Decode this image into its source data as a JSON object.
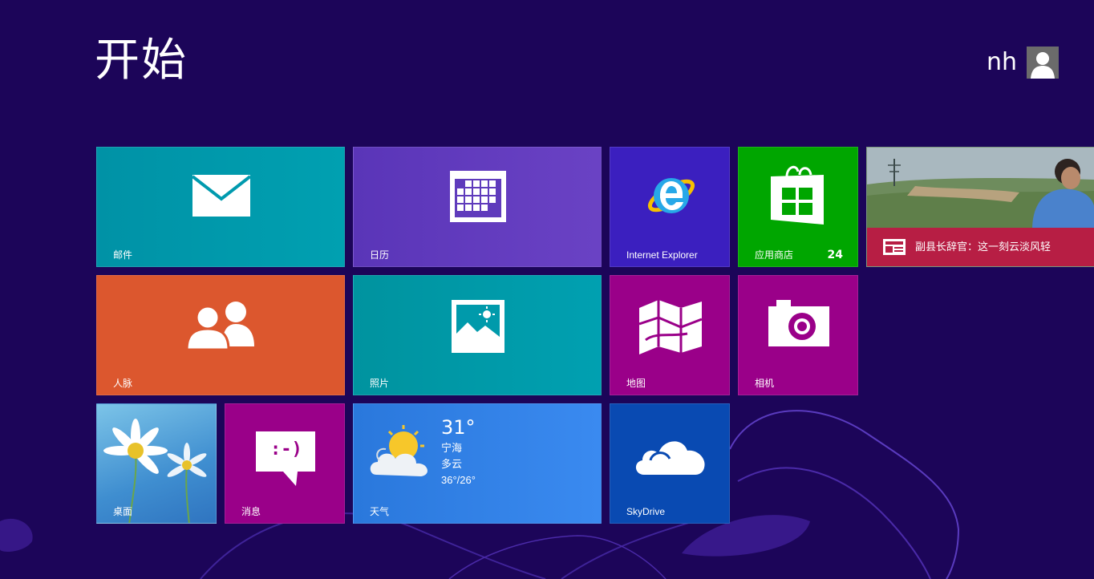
{
  "header": {
    "title": "开始"
  },
  "user": {
    "name": "nh",
    "avatar_icon": "user-avatar-icon"
  },
  "tiles": {
    "mail": {
      "label": "邮件",
      "color": "#00a0b1",
      "icon": "mail-icon"
    },
    "calendar": {
      "label": "日历",
      "color": "#643ebf",
      "icon": "calendar-icon"
    },
    "ie": {
      "label": "Internet Explorer",
      "color": "#3b1fbf",
      "icon": "internet-explorer-icon"
    },
    "store": {
      "label": "应用商店",
      "badge": "24",
      "color": "#00a600",
      "icon": "store-icon"
    },
    "news": {
      "headline": "副县长辞官：这一刻云淡风轻",
      "color": "#b71e44",
      "icon": "news-icon"
    },
    "people": {
      "label": "人脉",
      "color": "#dc572e",
      "icon": "people-icon"
    },
    "photos": {
      "label": "照片",
      "color": "#00a0b1",
      "icon": "photos-icon"
    },
    "maps": {
      "label": "地图",
      "color": "#9a0089",
      "icon": "map-icon"
    },
    "camera": {
      "label": "相机",
      "color": "#9a0089",
      "icon": "camera-icon"
    },
    "desktop": {
      "label": "桌面",
      "color": "#3f9ad4",
      "icon": "desktop-wallpaper"
    },
    "messaging": {
      "label": "消息",
      "color": "#9a0089",
      "icon": "messaging-icon",
      "emoticon": ":-)"
    },
    "weather": {
      "label": "天气",
      "color": "#2d7de0",
      "icon": "weather-partly-cloudy-icon",
      "temperature": "31°",
      "city": "宁海",
      "condition": "多云",
      "range": "36°/26°"
    },
    "skydrive": {
      "label": "SkyDrive",
      "color": "#094ab2",
      "icon": "skydrive-cloud-icon"
    }
  },
  "theme": {
    "background": "#1c0559",
    "accent_swirl": "#5a3bbf"
  }
}
